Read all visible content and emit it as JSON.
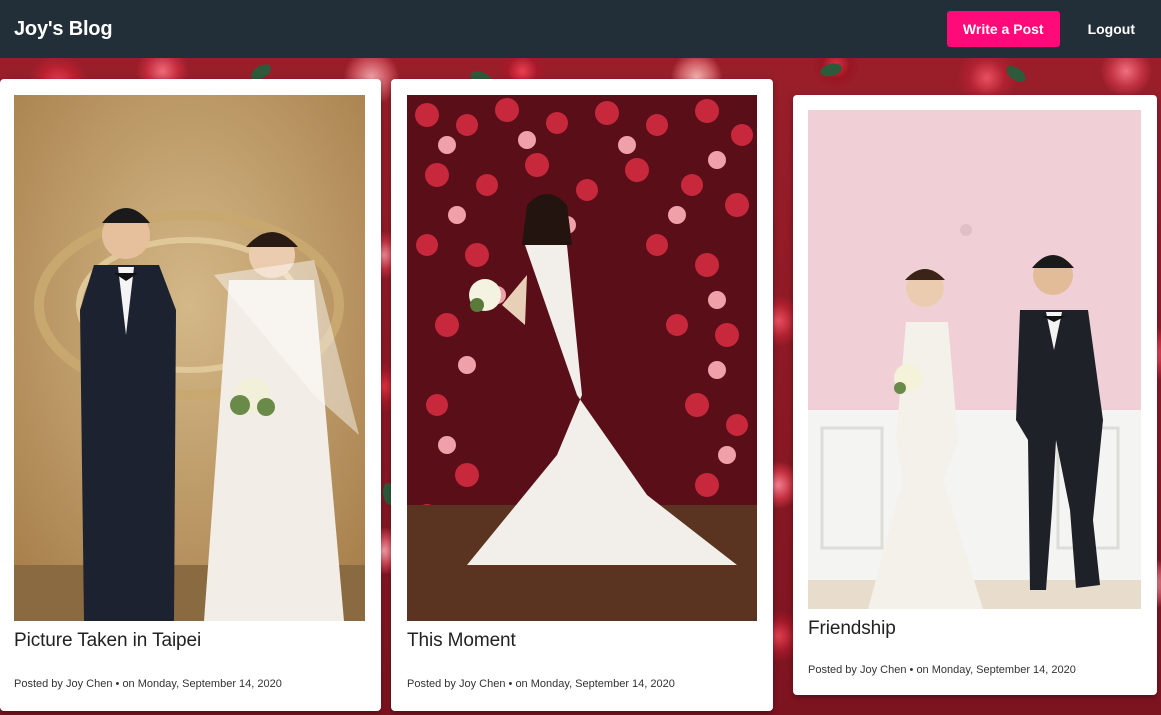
{
  "navbar": {
    "brand": "Joy's Blog",
    "write_post_label": "Write a Post",
    "logout_label": "Logout",
    "accent_color": "#ff0a78",
    "bar_color": "#232f38"
  },
  "posts": [
    {
      "title": "Picture Taken in Taipei",
      "posted_by_prefix": "Posted by",
      "author": "Joy Chen",
      "date_prefix": "• on",
      "date": "Monday, September 14, 2020",
      "image_icon": "wedding-couple-photo"
    },
    {
      "title": "This Moment",
      "posted_by_prefix": "Posted by",
      "author": "Joy Chen",
      "date_prefix": "• on",
      "date": "Monday, September 14, 2020",
      "image_icon": "bride-rose-wall-photo"
    },
    {
      "title": "Friendship",
      "posted_by_prefix": "Posted by",
      "author": "Joy Chen",
      "date_prefix": "• on",
      "date": "Monday, September 14, 2020",
      "image_icon": "couple-pink-wall-photo"
    }
  ]
}
